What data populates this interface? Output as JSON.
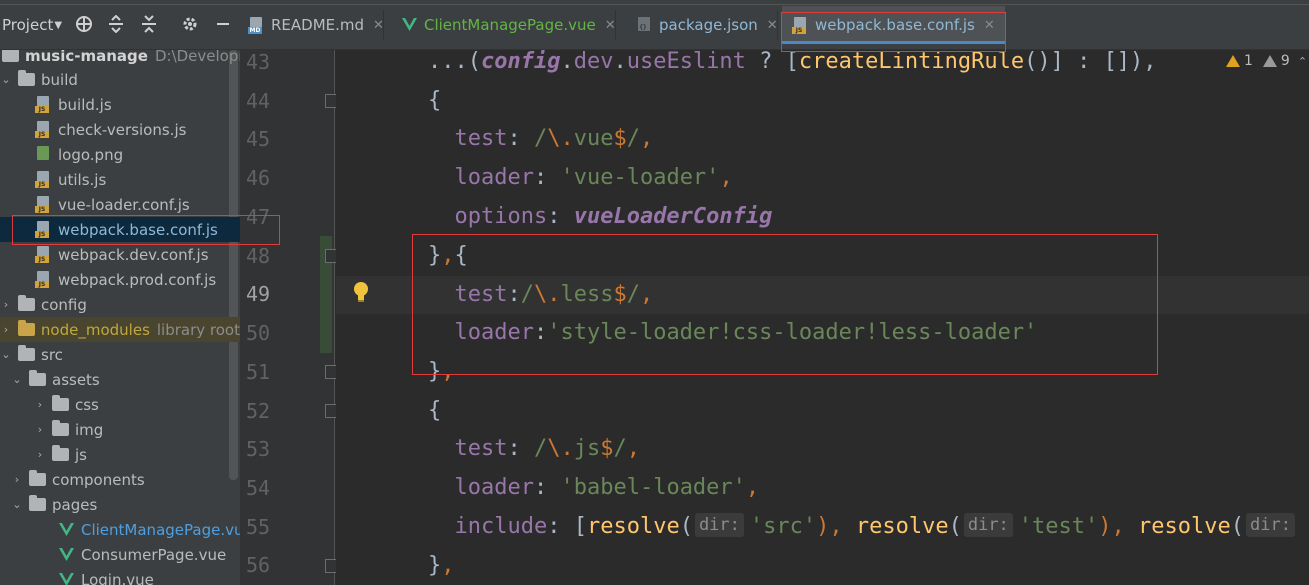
{
  "toolbar": {
    "project_label": "Project",
    "icons": [
      "crosshair-icon",
      "expand-all-icon",
      "collapse-all-icon",
      "gear-icon",
      "minimize-icon"
    ]
  },
  "tabs": [
    {
      "label": "README.md",
      "type": "md",
      "active": false
    },
    {
      "label": "ClientManagePage.vue",
      "type": "vue",
      "active": false
    },
    {
      "label": "package.json",
      "type": "json",
      "active": false
    },
    {
      "label": "webpack.base.conf.js",
      "type": "js",
      "active": true
    }
  ],
  "tree": {
    "root": {
      "name": "music-manage",
      "path": "D:\\Developme"
    },
    "items": [
      {
        "label": "build",
        "kind": "folder",
        "expanded": true
      },
      {
        "label": "build.js",
        "kind": "js"
      },
      {
        "label": "check-versions.js",
        "kind": "js"
      },
      {
        "label": "logo.png",
        "kind": "png"
      },
      {
        "label": "utils.js",
        "kind": "js"
      },
      {
        "label": "vue-loader.conf.js",
        "kind": "js"
      },
      {
        "label": "webpack.base.conf.js",
        "kind": "js",
        "selected": true
      },
      {
        "label": "webpack.dev.conf.js",
        "kind": "js"
      },
      {
        "label": "webpack.prod.conf.js",
        "kind": "js"
      },
      {
        "label": "config",
        "kind": "folder"
      },
      {
        "label": "node_modules",
        "hint": "library root",
        "kind": "excluded"
      },
      {
        "label": "src",
        "kind": "folder",
        "expanded": true
      },
      {
        "label": "assets",
        "kind": "folder",
        "expanded": true
      },
      {
        "label": "css",
        "kind": "folder"
      },
      {
        "label": "img",
        "kind": "folder"
      },
      {
        "label": "js",
        "kind": "folder"
      },
      {
        "label": "components",
        "kind": "folder"
      },
      {
        "label": "pages",
        "kind": "folder",
        "expanded": true
      },
      {
        "label": "ClientManagePage.vu",
        "kind": "vue"
      },
      {
        "label": "ConsumerPage.vue",
        "kind": "vue"
      },
      {
        "label": "Login.vue",
        "kind": "vue"
      }
    ]
  },
  "inspections": {
    "warnings": "1",
    "weak_warnings": "9"
  },
  "editor": {
    "current_line": "49",
    "line_numbers": [
      "43",
      "44",
      "45",
      "46",
      "47",
      "48",
      "49",
      "50",
      "51",
      "52",
      "53",
      "54",
      "55",
      "56"
    ],
    "code": {
      "l43": {
        "a": "...(",
        "b": "config",
        "c": ".",
        "d": "dev",
        "e": ".",
        "f": "useEslint",
        "g": " ? [",
        "h": "createLintingRule",
        "i": "()] : []),",
        "j": ""
      },
      "l44": {
        "a": "{"
      },
      "l45": {
        "key": "test",
        "colon": ": ",
        "regex1": "/",
        "regex2": "\\.",
        "regex3": "vue",
        "regex4": "$",
        "regex5": "/",
        "tail": ","
      },
      "l46": {
        "key": "loader",
        "colon": ": ",
        "str": "'vue-loader'",
        "tail": ","
      },
      "l47": {
        "key": "options",
        "colon": ": ",
        "val": "vueLoaderConfig"
      },
      "l48": {
        "a": "}",
        "b": ",",
        "c": "{"
      },
      "l49": {
        "key": "test",
        "colon": ":",
        "regex1": "/",
        "regex2": "\\.",
        "regex3": "less",
        "regex4": "$",
        "regex5": "/",
        "tail": ","
      },
      "l50": {
        "key": "loader",
        "colon": ":",
        "str": "'style-loader!css-loader!less-loader'"
      },
      "l51": {
        "a": "}",
        "b": ","
      },
      "l52": {
        "a": "{"
      },
      "l53": {
        "key": "test",
        "colon": ": ",
        "regex1": "/",
        "regex2": "\\.",
        "regex3": "js",
        "regex4": "$",
        "regex5": "/",
        "tail": ","
      },
      "l54": {
        "key": "loader",
        "colon": ": ",
        "str": "'babel-loader'",
        "tail": ","
      },
      "l55": {
        "key": "include",
        "colon": ": [",
        "fn1": "resolve",
        "p1": "(",
        "hint1": "dir:",
        "s1": "'src'",
        "c1": "), ",
        "fn2": "resolve",
        "p2": "(",
        "hint2": "dir:",
        "s2": "'test'",
        "c2": "), ",
        "fn3": "resolve",
        "p3": "(",
        "hint3": "dir:"
      },
      "l56": {
        "a": "}",
        "b": ","
      }
    }
  }
}
